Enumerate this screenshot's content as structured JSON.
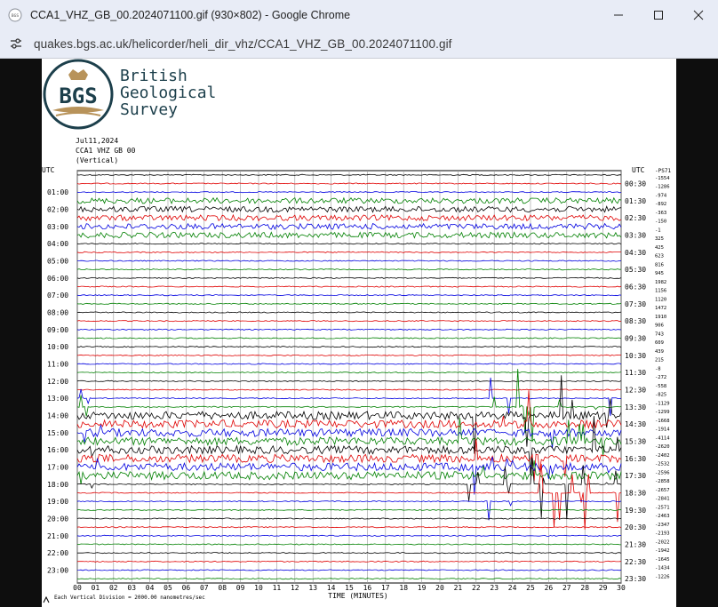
{
  "window": {
    "title": "CCA1_VHZ_GB_00.2024071100.gif (930×802) - Google Chrome"
  },
  "address": {
    "url": "quakes.bgs.ac.uk/helicorder/heli_dir_vhz/CCA1_VHZ_GB_00.2024071100.gif"
  },
  "logo": {
    "badge": "BGS",
    "line1": "British",
    "line2": "Geological",
    "line3": "Survey"
  },
  "plot": {
    "date": "Jul11,2024",
    "station": "CCA1 VHZ GB 00",
    "component": "(Vertical)",
    "utc_label": "UTC",
    "ps_label": "-PS71",
    "left_times": [
      "01:00",
      "02:00",
      "03:00",
      "04:00",
      "05:00",
      "06:00",
      "07:00",
      "08:00",
      "09:00",
      "10:00",
      "11:00",
      "12:00",
      "13:00",
      "14:00",
      "15:00",
      "16:00",
      "17:00",
      "18:00",
      "19:00",
      "20:00",
      "21:00",
      "22:00",
      "23:00"
    ],
    "right_times": [
      "00:30",
      "01:30",
      "02:30",
      "03:30",
      "04:30",
      "05:30",
      "06:30",
      "07:30",
      "08:30",
      "09:30",
      "10:30",
      "11:30",
      "12:30",
      "13:30",
      "14:30",
      "15:30",
      "16:30",
      "17:30",
      "18:30",
      "19:30",
      "20:30",
      "21:30",
      "22:30",
      "23:30"
    ],
    "offsets": [
      "-1554",
      "-1286",
      "-974",
      "-892",
      "-363",
      "-150",
      "-1",
      "325",
      "425",
      "623",
      "816",
      "945",
      "1982",
      "1156",
      "1120",
      "1472",
      "1910",
      "906",
      "743",
      "609",
      "439",
      "215",
      "-8",
      "-272",
      "-558",
      "-825",
      "-1129",
      "-1299",
      "-1668",
      "-1914",
      "-4114",
      "-2620",
      "-2402",
      "-2532",
      "-2596",
      "-2858",
      "-2657",
      "-2841",
      "-2571",
      "-2463",
      "-2347",
      "-2193",
      "-2022",
      "-1942",
      "-1645",
      "-1434",
      "-1226"
    ],
    "x_ticks": [
      "00",
      "01",
      "02",
      "03",
      "04",
      "05",
      "06",
      "07",
      "08",
      "09",
      "10",
      "11",
      "12",
      "13",
      "14",
      "15",
      "16",
      "17",
      "18",
      "19",
      "20",
      "21",
      "22",
      "23",
      "24",
      "25",
      "26",
      "27",
      "28",
      "29",
      "30"
    ],
    "x_label": "TIME (MINUTES)",
    "footnote": "Each Vertical Division = 2000.00 nanometres/sec",
    "trace_colors": [
      "#000000",
      "#e00000",
      "#0000e0",
      "#008000"
    ]
  }
}
